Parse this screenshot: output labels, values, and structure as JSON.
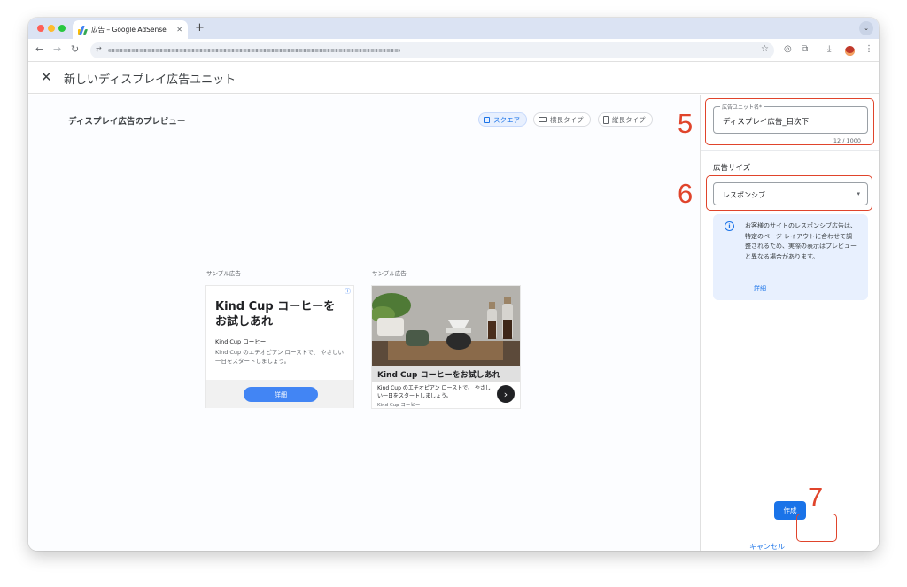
{
  "browser": {
    "tab_title": "広告 – Google AdSense",
    "tab_close": "✕",
    "new_tab": "+",
    "tab_menu": "⌄",
    "nav": {
      "back": "←",
      "forward": "→",
      "reload": "↻"
    },
    "omnibox_tune": "⇄",
    "bookmark": "☆",
    "extensions": [
      "◎",
      "⧉",
      "⤓",
      "⋮"
    ]
  },
  "header": {
    "close": "✕",
    "title": "新しいディスプレイ広告ユニット"
  },
  "preview": {
    "title": "ディスプレイ広告のプレビュー",
    "chips": [
      {
        "label": "スクエア",
        "active": true
      },
      {
        "label": "横長タイプ",
        "active": false
      },
      {
        "label": "縦長タイプ",
        "active": false
      }
    ],
    "ad1": {
      "label": "サンプル広告",
      "info": "ⓘ",
      "headline": "Kind Cup コーヒーを お試しあれ",
      "brand": "Kind Cup コーヒー",
      "body": "Kind Cup のエチオピアン ローストで、 やさしい一日をスタートしましょう。",
      "cta": "詳細"
    },
    "ad2": {
      "label": "サンプル広告",
      "headline": "Kind Cup コーヒーをお試しあれ",
      "body": "Kind Cup のエチオピアン ローストで、 やさしい一日をスタートしましょう。",
      "brand": "Kind Cup コーヒー",
      "arrow": "›"
    }
  },
  "panel": {
    "name_label": "広告ユニット名*",
    "name_value": "ディスプレイ広告_目次下",
    "counter": "12 / 1000",
    "size_title": "広告サイズ",
    "size_value": "レスポンシブ",
    "size_caret": "▾",
    "info_icon": "i",
    "info_text": "お客様のサイトのレスポンシブ広告は、特定のページ レイアウトに合わせて調整されるため、実際の表示はプレビューと異なる場合があります。",
    "info_link": "詳細",
    "cancel": "キャンセル",
    "create": "作成"
  },
  "annotations": {
    "n5": "5",
    "n6": "6",
    "n7": "7"
  },
  "colors": {
    "accent": "#1a73e8",
    "annotation": "#e0442b",
    "ad_cta": "#4285f4"
  }
}
